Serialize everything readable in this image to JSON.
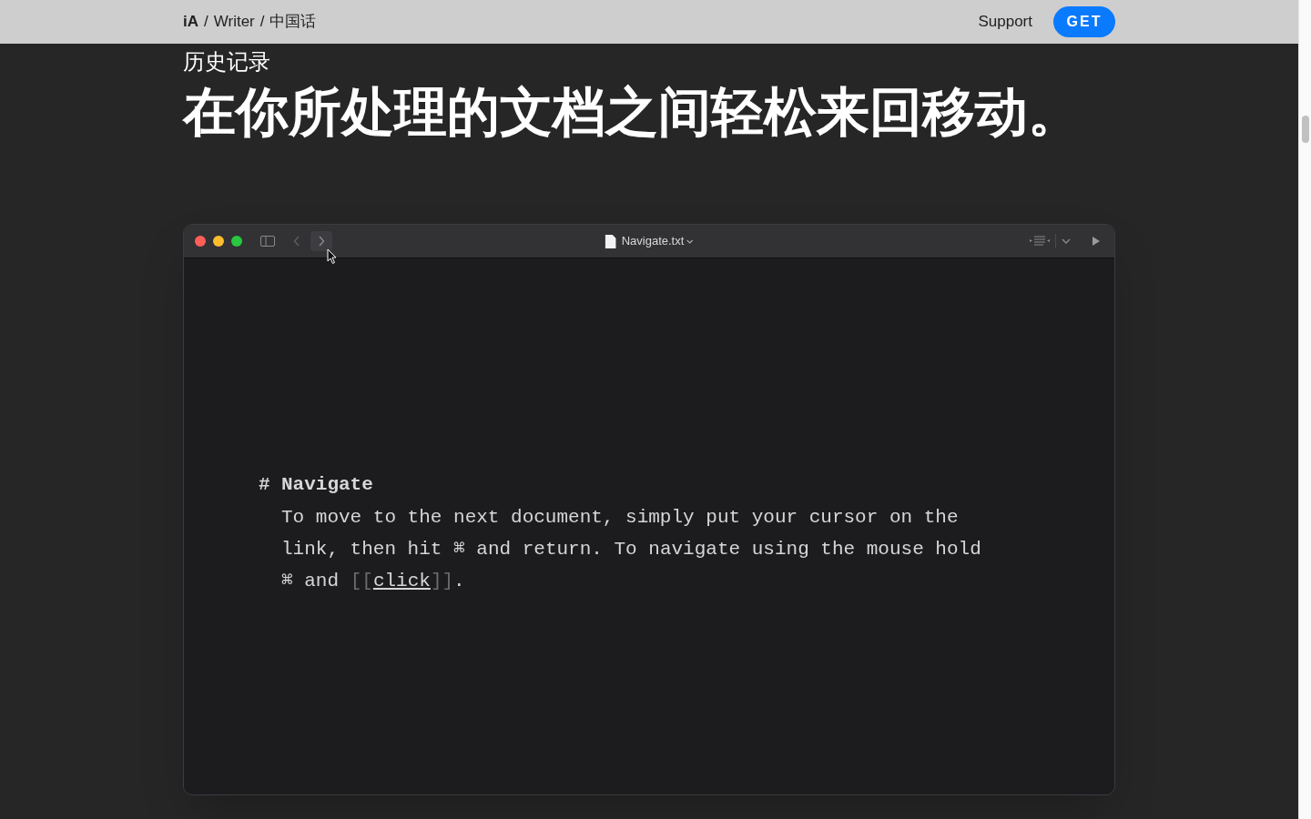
{
  "nav": {
    "breadcrumb": [
      {
        "kind": "brand",
        "text": "iA"
      },
      {
        "kind": "sep",
        "text": "/"
      },
      {
        "kind": "link",
        "text": "Writer"
      },
      {
        "kind": "sep",
        "text": "/"
      },
      {
        "kind": "link",
        "text": "中国话"
      }
    ],
    "support": "Support",
    "get": "GET"
  },
  "section": {
    "eyebrow": "历史记录",
    "title": "在你所处理的文档之间轻松来回移动。"
  },
  "window": {
    "file_name": "Navigate.txt",
    "back_disabled": true,
    "forward_hover": true
  },
  "editor": {
    "heading_mark": "#",
    "heading": "Navigate",
    "paragraph": {
      "before": "To move to the next document, simply put your cursor on the link, then hit ⌘ and return. To navigate using the mouse hold ⌘ and ",
      "link_open": "[[",
      "link": "click",
      "link_close": "]]",
      "after": "."
    }
  }
}
